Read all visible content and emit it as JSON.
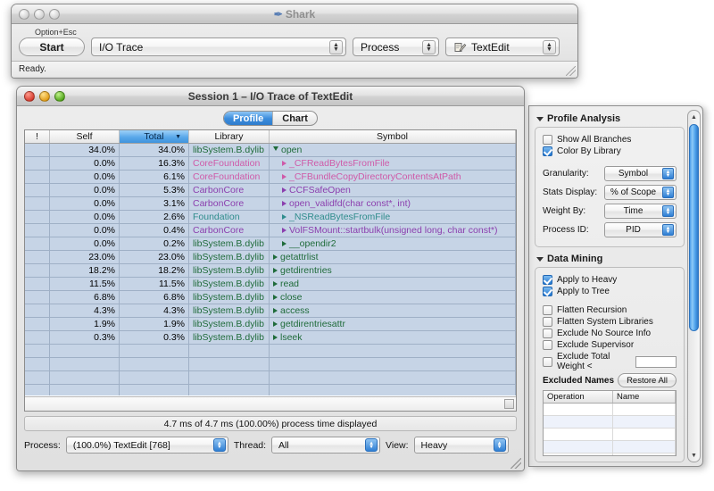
{
  "shark_window": {
    "title": "Shark",
    "title_icon": "shark-fin-icon",
    "shortcut_label": "Option+Esc",
    "start_button": "Start",
    "config_popup": "I/O Trace",
    "target_popup": "Process",
    "app_popup": "TextEdit",
    "app_icon": "textedit-icon",
    "status": "Ready."
  },
  "session_window": {
    "title": "Session 1 – I/O Trace of TextEdit",
    "tabs": [
      {
        "label": "Profile",
        "active": true
      },
      {
        "label": "Chart",
        "active": false
      }
    ],
    "table": {
      "columns": [
        {
          "key": "bang",
          "label": "!",
          "sorted": false
        },
        {
          "key": "self",
          "label": "Self",
          "sorted": false
        },
        {
          "key": "total",
          "label": "Total",
          "sorted": true,
          "sort_indicator": "▼"
        },
        {
          "key": "library",
          "label": "Library",
          "sorted": false
        },
        {
          "key": "symbol",
          "label": "Symbol",
          "sorted": false
        }
      ],
      "library_colors": {
        "libSystem.B.dylib": "#1f6b3a",
        "CoreFoundation": "#cf5aa8",
        "CarbonCore": "#8b3fae",
        "Foundation": "#2f8c8c"
      },
      "rows": [
        {
          "bang": "",
          "self": "34.0%",
          "total": "34.0%",
          "library": "libSystem.B.dylib",
          "symbol": "open",
          "indent": 0,
          "disclosure": "open"
        },
        {
          "bang": "",
          "self": "0.0%",
          "total": "16.3%",
          "library": "CoreFoundation",
          "symbol": "_CFReadBytesFromFile",
          "indent": 1,
          "disclosure": "closed"
        },
        {
          "bang": "",
          "self": "0.0%",
          "total": "6.1%",
          "library": "CoreFoundation",
          "symbol": "_CFBundleCopyDirectoryContentsAtPath",
          "indent": 1,
          "disclosure": "closed"
        },
        {
          "bang": "",
          "self": "0.0%",
          "total": "5.3%",
          "library": "CarbonCore",
          "symbol": "CCFSafeOpen",
          "indent": 1,
          "disclosure": "closed"
        },
        {
          "bang": "",
          "self": "0.0%",
          "total": "3.1%",
          "library": "CarbonCore",
          "symbol": "open_validfd(char const*, int)",
          "indent": 1,
          "disclosure": "closed"
        },
        {
          "bang": "",
          "self": "0.0%",
          "total": "2.6%",
          "library": "Foundation",
          "symbol": "_NSReadBytesFromFile",
          "indent": 1,
          "disclosure": "closed"
        },
        {
          "bang": "",
          "self": "0.0%",
          "total": "0.4%",
          "library": "CarbonCore",
          "symbol": "VolFSMount::startbulk(unsigned long, char const*)",
          "indent": 1,
          "disclosure": "closed"
        },
        {
          "bang": "",
          "self": "0.0%",
          "total": "0.2%",
          "library": "libSystem.B.dylib",
          "symbol": "__opendir2",
          "indent": 1,
          "disclosure": "closed"
        },
        {
          "bang": "",
          "self": "23.0%",
          "total": "23.0%",
          "library": "libSystem.B.dylib",
          "symbol": "getattrlist",
          "indent": 0,
          "disclosure": "closed"
        },
        {
          "bang": "",
          "self": "18.2%",
          "total": "18.2%",
          "library": "libSystem.B.dylib",
          "symbol": "getdirentries",
          "indent": 0,
          "disclosure": "closed"
        },
        {
          "bang": "",
          "self": "11.5%",
          "total": "11.5%",
          "library": "libSystem.B.dylib",
          "symbol": "read",
          "indent": 0,
          "disclosure": "closed"
        },
        {
          "bang": "",
          "self": "6.8%",
          "total": "6.8%",
          "library": "libSystem.B.dylib",
          "symbol": "close",
          "indent": 0,
          "disclosure": "closed"
        },
        {
          "bang": "",
          "self": "4.3%",
          "total": "4.3%",
          "library": "libSystem.B.dylib",
          "symbol": "access",
          "indent": 0,
          "disclosure": "closed"
        },
        {
          "bang": "",
          "self": "1.9%",
          "total": "1.9%",
          "library": "libSystem.B.dylib",
          "symbol": "getdirentriesattr",
          "indent": 0,
          "disclosure": "closed"
        },
        {
          "bang": "",
          "self": "0.3%",
          "total": "0.3%",
          "library": "libSystem.B.dylib",
          "symbol": "lseek",
          "indent": 0,
          "disclosure": "closed"
        },
        {
          "bang": "",
          "self": "",
          "total": "",
          "library": "",
          "symbol": "",
          "indent": 0,
          "disclosure": ""
        },
        {
          "bang": "",
          "self": "",
          "total": "",
          "library": "",
          "symbol": "",
          "indent": 0,
          "disclosure": ""
        },
        {
          "bang": "",
          "self": "",
          "total": "",
          "library": "",
          "symbol": "",
          "indent": 0,
          "disclosure": ""
        },
        {
          "bang": "",
          "self": "",
          "total": "",
          "library": "",
          "symbol": "",
          "indent": 0,
          "disclosure": ""
        },
        {
          "bang": "",
          "self": "",
          "total": "",
          "library": "",
          "symbol": "",
          "indent": 0,
          "disclosure": ""
        },
        {
          "bang": "",
          "self": "",
          "total": "",
          "library": "",
          "symbol": "",
          "indent": 0,
          "disclosure": ""
        }
      ]
    },
    "summary": "4.7 ms of 4.7 ms (100.00%) process time displayed",
    "footer": {
      "process_label": "Process:",
      "process_value": "(100.0%) TextEdit [768]",
      "thread_label": "Thread:",
      "thread_value": "All",
      "view_label": "View:",
      "view_value": "Heavy"
    }
  },
  "inspector": {
    "profile_analysis": {
      "title": "Profile Analysis",
      "checkboxes": [
        {
          "label": "Show All Branches",
          "checked": false
        },
        {
          "label": "Color By Library",
          "checked": true
        }
      ],
      "fields": [
        {
          "label": "Granularity:",
          "value": "Symbol"
        },
        {
          "label": "Stats Display:",
          "value": "% of Scope"
        },
        {
          "label": "Weight By:",
          "value": "Time"
        },
        {
          "label": "Process ID:",
          "value": "PID"
        }
      ]
    },
    "data_mining": {
      "title": "Data Mining",
      "checkboxes": [
        {
          "label": "Apply to Heavy",
          "checked": true
        },
        {
          "label": "Apply to Tree",
          "checked": true
        },
        {
          "label": "Flatten Recursion",
          "checked": false
        },
        {
          "label": "Flatten System Libraries",
          "checked": false
        },
        {
          "label": "Exclude No Source Info",
          "checked": false
        },
        {
          "label": "Exclude Supervisor",
          "checked": false
        },
        {
          "label": "Exclude Total Weight <",
          "checked": false,
          "has_input": true,
          "input_value": ""
        }
      ],
      "excluded_names": {
        "label": "Excluded Names",
        "restore_button": "Restore All",
        "columns": [
          "Operation",
          "Name"
        ],
        "rows": [
          {
            "operation": "",
            "name": ""
          },
          {
            "operation": "",
            "name": ""
          },
          {
            "operation": "",
            "name": ""
          },
          {
            "operation": "",
            "name": ""
          },
          {
            "operation": "",
            "name": ""
          }
        ]
      }
    }
  }
}
